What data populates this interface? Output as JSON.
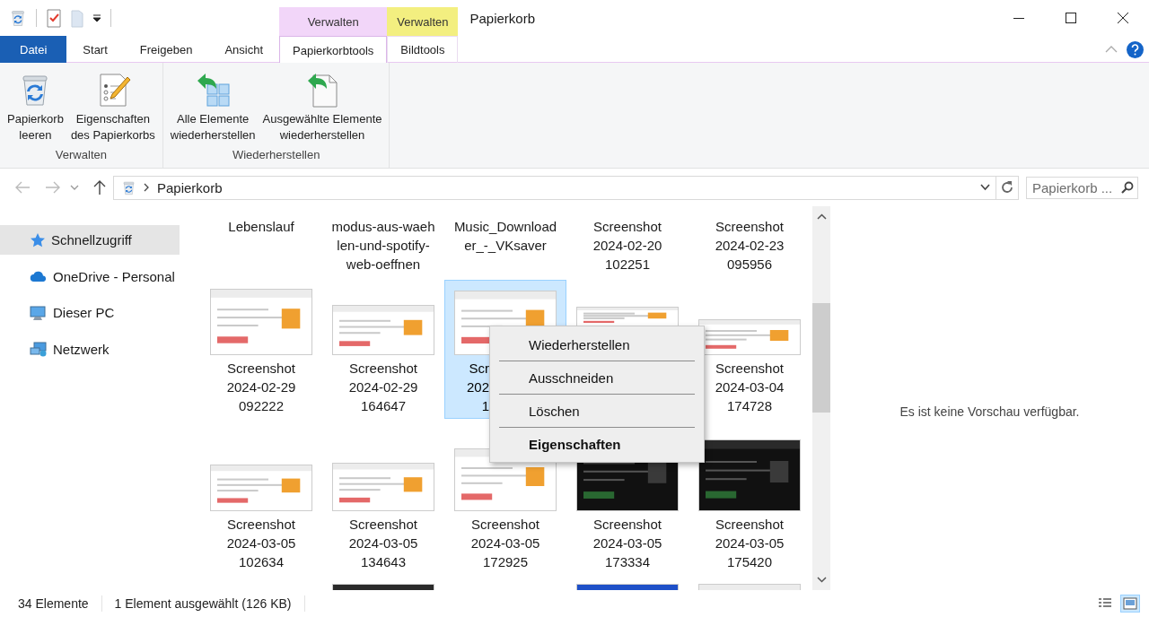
{
  "window": {
    "title": "Papierkorb"
  },
  "context_headers": [
    {
      "label": "Verwalten",
      "color": "#f2d6f9"
    },
    {
      "label": "Verwalten",
      "color": "#f3ef80"
    }
  ],
  "tabs": [
    {
      "label": "Datei",
      "kind": "file",
      "selected": false
    },
    {
      "label": "Start",
      "kind": "plain",
      "selected": false
    },
    {
      "label": "Freigeben",
      "kind": "plain",
      "selected": false
    },
    {
      "label": "Ansicht",
      "kind": "plain",
      "selected": false
    },
    {
      "label": "Papierkorbtools",
      "kind": "contextual",
      "selected": true
    },
    {
      "label": "Bildtools",
      "kind": "contextual",
      "selected": false
    }
  ],
  "ribbon": {
    "groups": [
      {
        "label": "Verwalten",
        "buttons": [
          {
            "lines": [
              "Papierkorb",
              "leeren"
            ]
          },
          {
            "lines": [
              "Eigenschaften",
              "des Papierkorbs"
            ]
          }
        ]
      },
      {
        "label": "Wiederherstellen",
        "buttons": [
          {
            "lines": [
              "Alle Elemente",
              "wiederherstellen"
            ]
          },
          {
            "lines": [
              "Ausgewählte Elemente",
              "wiederherstellen"
            ]
          }
        ]
      }
    ]
  },
  "address_bar": {
    "path": [
      "Papierkorb"
    ],
    "search": {
      "placeholder": "Papierkorb ..."
    }
  },
  "sidebar": {
    "items": [
      {
        "label": "Schnellzugriff",
        "selected": true
      },
      {
        "label": "OneDrive - Personal",
        "selected": false
      },
      {
        "label": "Dieser PC",
        "selected": false
      },
      {
        "label": "Netzwerk",
        "selected": false
      }
    ]
  },
  "files": {
    "rows": [
      [
        {
          "kind": "caption",
          "selected": false,
          "lines": [
            "Lebenslauf"
          ]
        },
        {
          "kind": "caption",
          "selected": false,
          "lines": [
            "modus-aus-waeh",
            "len-und-spotify-",
            "web-oeffnen"
          ]
        },
        {
          "kind": "caption",
          "selected": false,
          "lines": [
            "Music_Download",
            "er_-_VKsaver"
          ]
        },
        {
          "kind": "caption",
          "selected": false,
          "lines": [
            "Screenshot",
            "2024-02-20",
            "102251"
          ]
        },
        {
          "kind": "caption",
          "selected": false,
          "lines": [
            "Screenshot",
            "2024-02-23",
            "095956"
          ]
        }
      ],
      [
        {
          "kind": "file",
          "selected": false,
          "thumbnail": {
            "kind": "light"
          },
          "lines": [
            "Screenshot",
            "2024-02-29",
            "092222"
          ]
        },
        {
          "kind": "file",
          "selected": false,
          "thumbnail": {
            "kind": "light"
          },
          "lines": [
            "Screenshot",
            "2024-02-29",
            "164647"
          ]
        },
        {
          "kind": "covered",
          "selected": true,
          "thumbnail": {
            "kind": "light"
          },
          "lines": [
            "Scr",
            "202",
            "1"
          ]
        },
        {
          "kind": "thumb",
          "thumbnail": {
            "kind": "light"
          }
        },
        {
          "kind": "file",
          "selected": false,
          "thumbnail": {
            "kind": "light"
          },
          "lines": [
            "Screenshot",
            "2024-03-04",
            "174728"
          ]
        }
      ],
      [
        {
          "kind": "file",
          "selected": false,
          "thumbnail": {
            "kind": "light"
          },
          "lines": [
            "Screenshot",
            "2024-03-05",
            "102634"
          ]
        },
        {
          "kind": "file",
          "selected": false,
          "thumbnail": {
            "kind": "light"
          },
          "lines": [
            "Screenshot",
            "2024-03-05",
            "134643"
          ]
        },
        {
          "kind": "file",
          "selected": false,
          "thumbnail": {
            "kind": "light"
          },
          "lines": [
            "Screenshot",
            "2024-03-05",
            "172925"
          ]
        },
        {
          "kind": "file",
          "selected": false,
          "thumbnail": {
            "kind": "dark"
          },
          "lines": [
            "Screenshot",
            "2024-03-05",
            "173334"
          ]
        },
        {
          "kind": "file",
          "selected": false,
          "thumbnail": {
            "kind": "dark"
          },
          "lines": [
            "Screenshot",
            "2024-03-05",
            "175420"
          ]
        }
      ],
      [
        {
          "kind": "empty"
        },
        {
          "kind": "thumb",
          "selected": false,
          "thumbnail": {
            "kind": "dark"
          }
        },
        {
          "kind": "empty"
        },
        {
          "kind": "thumb",
          "selected": false,
          "thumbnail": {
            "kind": "blue"
          }
        },
        {
          "kind": "thumb",
          "selected": false,
          "thumbnail": {
            "kind": "light"
          }
        }
      ]
    ]
  },
  "context_menu": {
    "items": [
      {
        "label": "Wiederherstellen",
        "default": false
      },
      {
        "label": "Ausschneiden",
        "default": false
      },
      {
        "label": "Löschen",
        "default": false
      },
      {
        "label": "Eigenschaften",
        "default": true
      }
    ]
  },
  "preview": {
    "message": "Es ist keine Vorschau verfügbar."
  },
  "status_bar": {
    "count": "34 Elemente",
    "selection": "1 Element ausgewählt (126 KB)",
    "views": [
      {
        "selected": false
      },
      {
        "selected": true
      }
    ]
  }
}
